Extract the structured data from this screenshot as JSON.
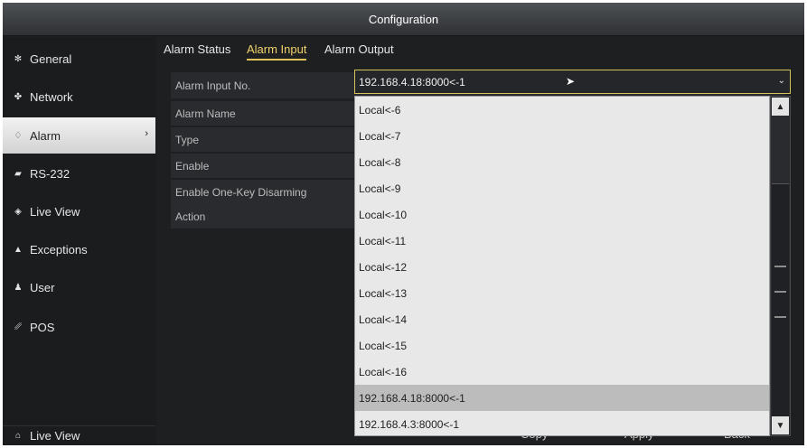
{
  "window": {
    "title": "Configuration"
  },
  "sidebar": {
    "items": [
      {
        "label": "General",
        "icon": "gear-icon",
        "glyph": "✻"
      },
      {
        "label": "Network",
        "icon": "network-icon",
        "glyph": "✤"
      },
      {
        "label": "Alarm",
        "icon": "alarm-bell-icon",
        "glyph": "♢",
        "chevron": "›"
      },
      {
        "label": "RS-232",
        "icon": "rs232-port-icon",
        "glyph": "▰"
      },
      {
        "label": "Live View",
        "icon": "eye-icon",
        "glyph": "◈"
      },
      {
        "label": "Exceptions",
        "icon": "warning-icon",
        "glyph": "▲"
      },
      {
        "label": "User",
        "icon": "users-icon",
        "glyph": "♟"
      },
      {
        "label": "POS",
        "icon": "pos-terminal-icon",
        "glyph": "␥"
      }
    ],
    "bottom": {
      "label": "Live View",
      "icon": "home-icon",
      "glyph": "⌂"
    }
  },
  "tabs": [
    {
      "label": "Alarm Status"
    },
    {
      "label": "Alarm Input",
      "active": true
    },
    {
      "label": "Alarm Output"
    }
  ],
  "form": {
    "alarm_input_no": "Alarm Input No.",
    "alarm_name": "Alarm Name",
    "type": "Type",
    "enable": "Enable",
    "one_key": "Enable One-Key Disarming",
    "action": "Action",
    "selected_value": "192.168.4.18:8000<-1"
  },
  "dropdown": {
    "options": [
      "Local<-6",
      "Local<-7",
      "Local<-8",
      "Local<-9",
      "Local<-10",
      "Local<-11",
      "Local<-12",
      "Local<-13",
      "Local<-14",
      "Local<-15",
      "Local<-16",
      "192.168.4.18:8000<-1",
      "192.168.4.3:8000<-1"
    ],
    "highlighted": "192.168.4.18:8000<-1"
  },
  "buttons": {
    "copy": "Copy",
    "apply": "Apply",
    "back": "Back"
  },
  "colors": {
    "accent": "#e0c45a",
    "active_bg": "#e0e0e0",
    "dark_bg": "#1e1f21"
  }
}
